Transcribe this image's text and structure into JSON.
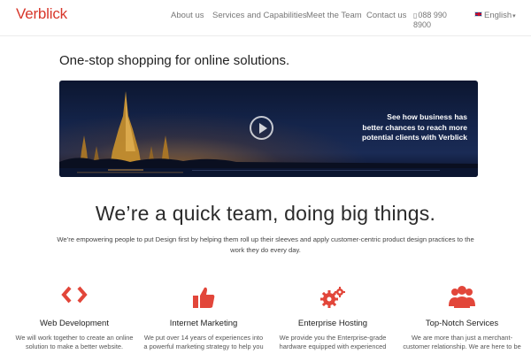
{
  "header": {
    "logo": "Verblick",
    "nav": [
      {
        "label": "About us"
      },
      {
        "label": "Services and Capabilities"
      },
      {
        "label": "Meet the Team"
      },
      {
        "label": "Contact us"
      }
    ],
    "phone": "088 990 8900",
    "language": "English"
  },
  "tagline": "One-stop shopping for online solutions.",
  "video": {
    "caption_line1": "See how business has",
    "caption_line2": "better chances to reach more",
    "caption_line3": "potential clients with Verblick"
  },
  "headline": "We’re a quick team, doing big things.",
  "intro": "We’re empowering people to put Design first by helping them roll up their sleeves and apply customer-centric product design practices to the work they do every day.",
  "services": [
    {
      "icon": "code-icon",
      "title": "Web Development",
      "text": "We will work together to create an online solution to make a better website."
    },
    {
      "icon": "thumbs-up-icon",
      "title": "Internet Marketing",
      "text": "We put over 14 years of experiences into a powerful marketing strategy to help you"
    },
    {
      "icon": "gears-icon",
      "title": "Enterprise Hosting",
      "text": "We provide you the Enterprise-grade hardware equipped with experienced"
    },
    {
      "icon": "users-icon",
      "title": "Top-Notch Services",
      "text": "We are more than just a merchant-customer relationship. We are here to be"
    }
  ],
  "colors": {
    "brand": "#d8372b",
    "icon": "#e2463a"
  }
}
